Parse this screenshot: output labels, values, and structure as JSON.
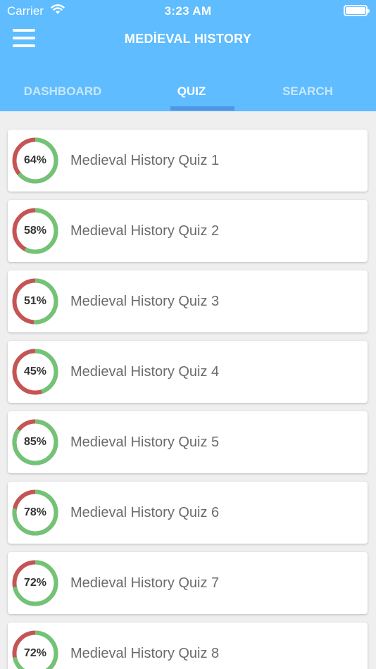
{
  "status_bar": {
    "carrier": "Carrier",
    "time": "3:23 AM"
  },
  "header": {
    "title": "MEDİEVAL HISTORY"
  },
  "tabs": [
    {
      "label": "DASHBOARD",
      "active": false
    },
    {
      "label": "QUIZ",
      "active": true
    },
    {
      "label": "SEARCH",
      "active": false
    }
  ],
  "colors": {
    "header": "#5ebcff",
    "correct": "#71c475",
    "incorrect": "#c55454",
    "indicator": "#4f97e6"
  },
  "quizzes": [
    {
      "title": "Medieval History Quiz 1",
      "score_label": "64%",
      "score": 64
    },
    {
      "title": "Medieval History Quiz 2",
      "score_label": "58%",
      "score": 58
    },
    {
      "title": "Medieval History Quiz 3",
      "score_label": "51%",
      "score": 51
    },
    {
      "title": "Medieval History Quiz 4",
      "score_label": "45%",
      "score": 45
    },
    {
      "title": "Medieval History Quiz 5",
      "score_label": "85%",
      "score": 85
    },
    {
      "title": "Medieval History Quiz 6",
      "score_label": "78%",
      "score": 78
    },
    {
      "title": "Medieval History Quiz 7",
      "score_label": "72%",
      "score": 72
    },
    {
      "title": "Medieval History Quiz 8",
      "score_label": "72%",
      "score": 72
    }
  ]
}
